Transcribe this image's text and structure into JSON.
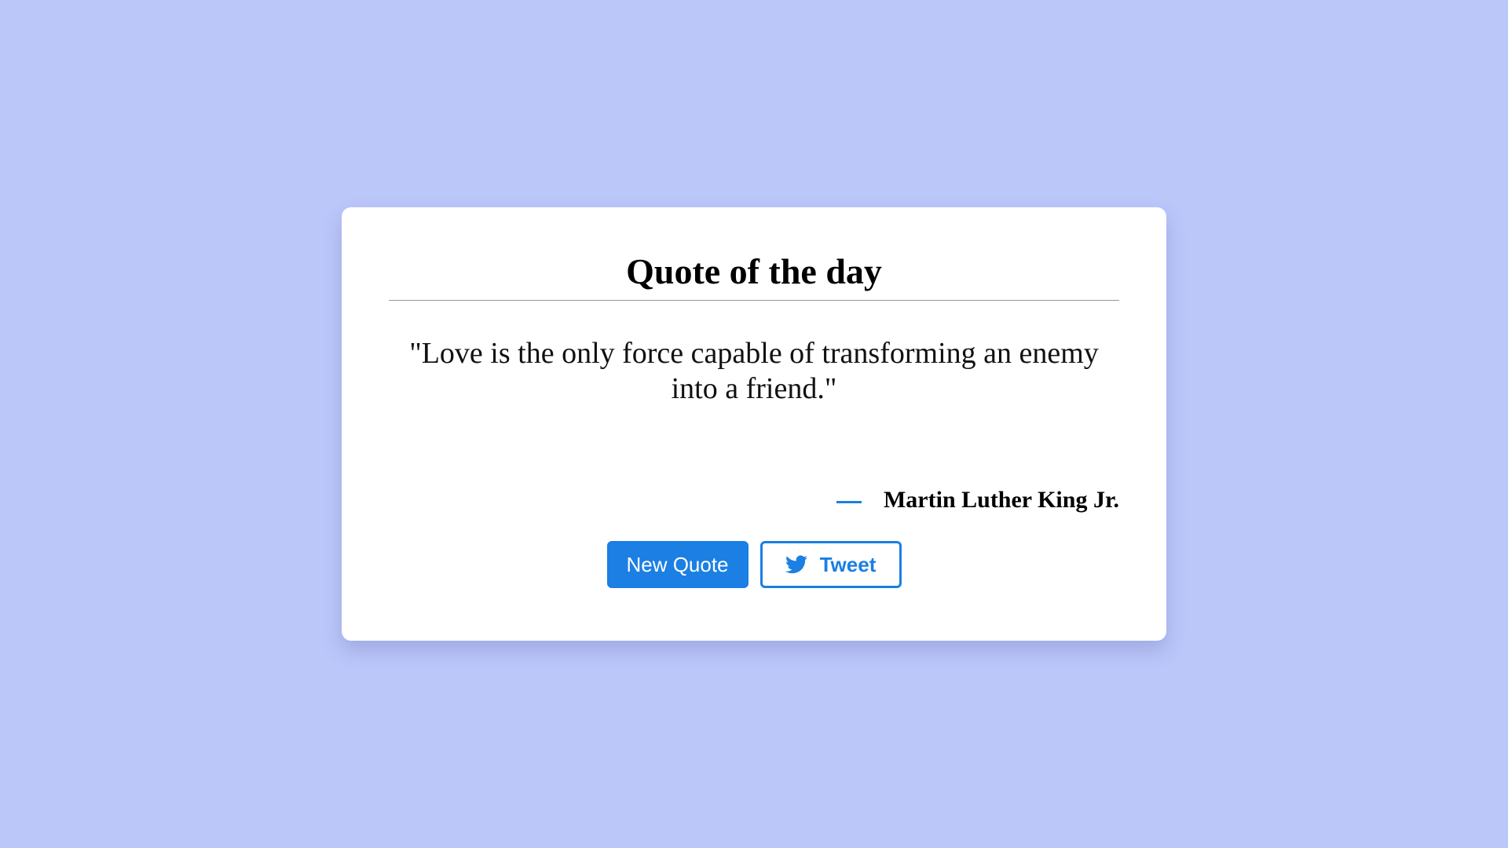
{
  "card": {
    "title": "Quote of the day",
    "quote": "\"Love is the only force capable of transforming an enemy into a friend.\"",
    "author_dash": "—",
    "author": "Martin Luther King Jr."
  },
  "buttons": {
    "new_quote_label": "New Quote",
    "tweet_label": "Tweet",
    "tweet_icon": "twitter-icon"
  },
  "colors": {
    "background": "#bbc6f9",
    "card": "#ffffff",
    "accent": "#1b7fe3"
  }
}
